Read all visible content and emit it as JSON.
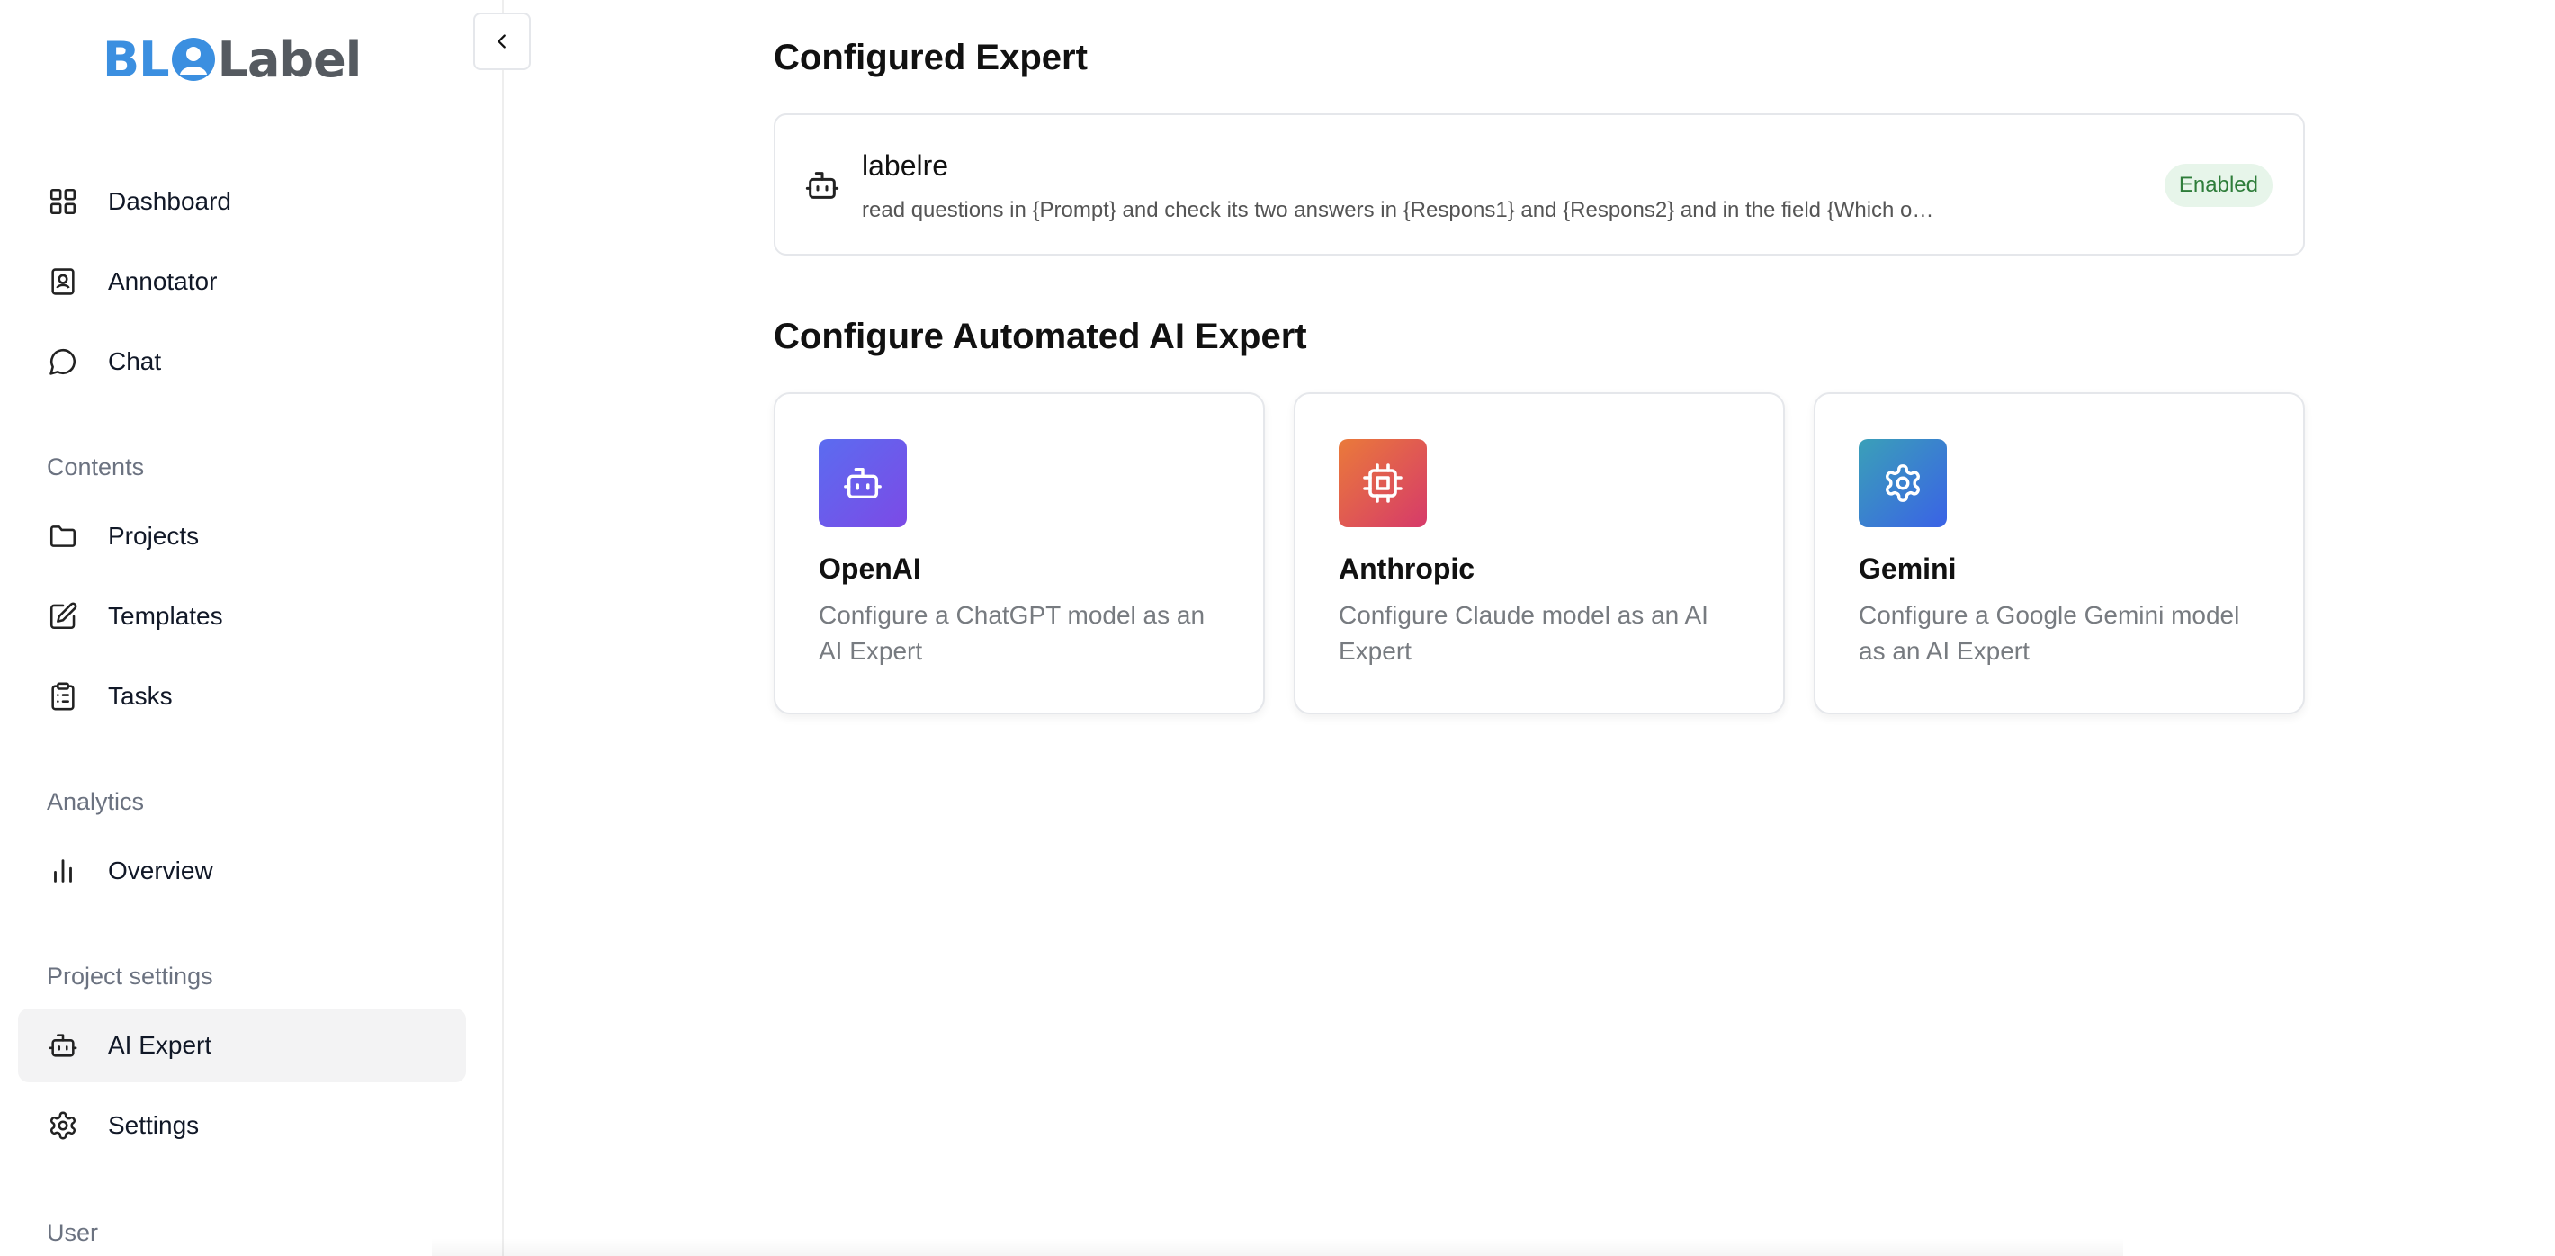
{
  "brand": {
    "logo_text_left": "BL",
    "logo_text_right": "Label",
    "logo_blue": "#3b8fe0",
    "logo_gray": "#555a60"
  },
  "sidebar": {
    "main_items": [
      {
        "label": "Dashboard",
        "icon": "grid-icon"
      },
      {
        "label": "Annotator",
        "icon": "contact-book-icon"
      },
      {
        "label": "Chat",
        "icon": "chat-bubble-icon"
      }
    ],
    "sections": {
      "contents": {
        "title": "Contents",
        "items": [
          {
            "label": "Projects",
            "icon": "folder-icon"
          },
          {
            "label": "Templates",
            "icon": "edit-icon"
          },
          {
            "label": "Tasks",
            "icon": "clipboard-icon"
          }
        ]
      },
      "analytics": {
        "title": "Analytics",
        "items": [
          {
            "label": "Overview",
            "icon": "bar-chart-icon"
          }
        ]
      },
      "project_settings": {
        "title": "Project settings",
        "items": [
          {
            "label": "AI Expert",
            "icon": "bot-icon",
            "active": true
          },
          {
            "label": "Settings",
            "icon": "gear-icon"
          }
        ]
      },
      "user": {
        "title": "User"
      }
    }
  },
  "main": {
    "configured_title": "Configured Expert",
    "configured_expert": {
      "name": "labelre",
      "description": "read questions in {Prompt} and check its two answers in {Respons1} and {Respons2} and in the field {Which o…",
      "status": "Enabled"
    },
    "configure_title": "Configure Automated AI Expert",
    "providers": [
      {
        "title": "OpenAI",
        "description": "Configure a ChatGPT model as an AI Expert",
        "icon": "bot-icon",
        "gradient": [
          "#5b6cf0",
          "#7c4ae6"
        ]
      },
      {
        "title": "Anthropic",
        "description": "Configure Claude model as an AI Expert",
        "icon": "chip-icon",
        "gradient": [
          "#ea7a3a",
          "#d63a6a"
        ]
      },
      {
        "title": "Gemini",
        "description": "Configure a Google Gemini model as an AI Expert",
        "icon": "gear-icon",
        "gradient": [
          "#3aa0b8",
          "#3a62e6"
        ]
      }
    ]
  }
}
